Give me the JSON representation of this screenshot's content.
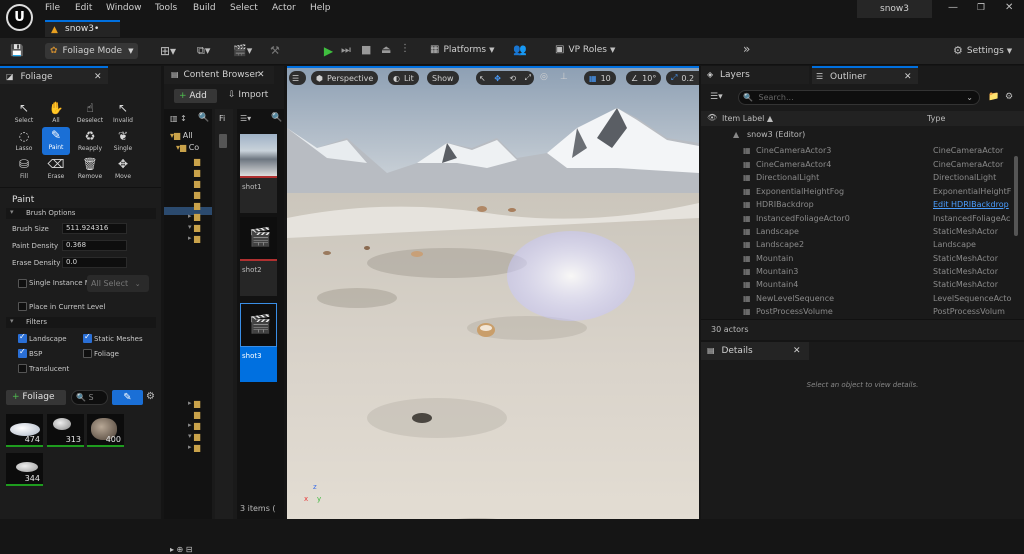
{
  "menu": {
    "items": [
      "File",
      "Edit",
      "Window",
      "Tools",
      "Build",
      "Select",
      "Actor",
      "Help"
    ],
    "project": "snow3"
  },
  "doc_tab": {
    "label": "snow3•"
  },
  "toolbar": {
    "mode": "Foliage Mode",
    "platforms": "Platforms",
    "vp_roles": "VP Roles",
    "settings": "Settings"
  },
  "foliage_panel": {
    "tab": "Foliage",
    "tools": [
      "Select",
      "All",
      "Deselect",
      "Invalid",
      "Lasso",
      "Paint",
      "Reapply",
      "Single",
      "Fill",
      "Erase",
      "Remove",
      "Move"
    ],
    "section": "Paint",
    "brush_options": "Brush Options",
    "brush_size_label": "Brush Size",
    "brush_size": "511.924316",
    "paint_density_label": "Paint Density",
    "paint_density": "0.368",
    "erase_density_label": "Erase Density",
    "erase_density": "0.0",
    "single_instance": "Single Instance Mode",
    "all_select": "All Select",
    "place_current": "Place in Current Level",
    "filters": "Filters",
    "landscape": "Landscape",
    "static_meshes": "Static Meshes",
    "bsp": "BSP",
    "foliage": "Foliage",
    "translucent": "Translucent",
    "add_foliage": "Foliage",
    "search_placeholder": "S",
    "counts": [
      "474",
      "313",
      "400",
      "344"
    ]
  },
  "content_browser": {
    "tab": "Content Browser",
    "add": "Add",
    "import": "Import",
    "tree_all": "All",
    "tree_co": "Co",
    "filter_label": "Fi",
    "items": [
      "shot1",
      "shot2",
      "shot3"
    ],
    "count": "3 items ("
  },
  "viewport": {
    "perspective": "Perspective",
    "lit": "Lit",
    "show": "Show",
    "grid": "10",
    "angle": "10°",
    "scale": "0.2"
  },
  "layers": {
    "tab": "Layers"
  },
  "outliner": {
    "tab": "Outliner",
    "search_placeholder": "Search...",
    "col_label": "Item Label ▲",
    "col_type": "Type",
    "root": "snow3 (Editor)",
    "rows": [
      {
        "name": "CineCameraActor3",
        "type": "CineCameraActor"
      },
      {
        "name": "CineCameraActor4",
        "type": "CineCameraActor"
      },
      {
        "name": "DirectionalLight",
        "type": "DirectionalLight"
      },
      {
        "name": "ExponentialHeightFog",
        "type": "ExponentialHeightF"
      },
      {
        "name": "HDRIBackdrop",
        "type": "Edit HDRIBackdrop"
      },
      {
        "name": "InstancedFoliageActor0",
        "type": "InstancedFoliageAc"
      },
      {
        "name": "Landscape",
        "type": "StaticMeshActor"
      },
      {
        "name": "Landscape2",
        "type": "Landscape"
      },
      {
        "name": "Mountain",
        "type": "StaticMeshActor"
      },
      {
        "name": "Mountain3",
        "type": "StaticMeshActor"
      },
      {
        "name": "Mountain4",
        "type": "StaticMeshActor"
      },
      {
        "name": "NewLevelSequence",
        "type": "LevelSequenceActo"
      },
      {
        "name": "PostProcessVolume",
        "type": "PostProcessVolum"
      }
    ],
    "actor_count": "30 actors"
  },
  "details": {
    "tab": "Details",
    "empty": "Select an object to view details."
  }
}
